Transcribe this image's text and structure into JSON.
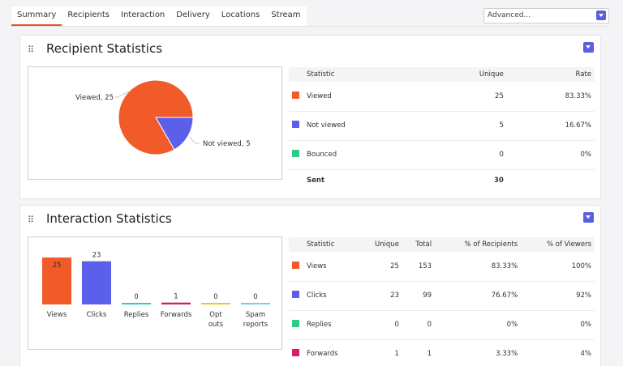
{
  "tabs": [
    {
      "label": "Summary",
      "active": true
    },
    {
      "label": "Recipients"
    },
    {
      "label": "Interaction"
    },
    {
      "label": "Delivery"
    },
    {
      "label": "Locations"
    },
    {
      "label": "Stream"
    }
  ],
  "view_select": {
    "value": "Advanced..."
  },
  "recipient_panel": {
    "title": "Recipient Statistics",
    "table": {
      "headers": [
        "Statistic",
        "Unique",
        "Rate"
      ],
      "rows": [
        {
          "label": "Viewed",
          "unique": "25",
          "rate": "83.33%",
          "color": "#f15a29"
        },
        {
          "label": "Not viewed",
          "unique": "5",
          "rate": "16.67%",
          "color": "#5b5fe9"
        },
        {
          "label": "Bounced",
          "unique": "0",
          "rate": "0%",
          "color": "#2ecc8a"
        }
      ],
      "total": {
        "label": "Sent",
        "unique": "30"
      }
    }
  },
  "interaction_panel": {
    "title": "Interaction Statistics",
    "table": {
      "headers": [
        "Statistic",
        "Unique",
        "Total",
        "% of Recipients",
        "% of Viewers"
      ],
      "rows": [
        {
          "label": "Views",
          "unique": "25",
          "total": "153",
          "pct_recipients": "83.33%",
          "pct_viewers": "100%",
          "color": "#f15a29"
        },
        {
          "label": "Clicks",
          "unique": "23",
          "total": "99",
          "pct_recipients": "76.67%",
          "pct_viewers": "92%",
          "color": "#5b5fe9"
        },
        {
          "label": "Replies",
          "unique": "0",
          "total": "0",
          "pct_recipients": "0%",
          "pct_viewers": "0%",
          "color": "#2ecc8a"
        },
        {
          "label": "Forwards",
          "unique": "1",
          "total": "1",
          "pct_recipients": "3.33%",
          "pct_viewers": "4%",
          "color": "#d81b6a"
        }
      ]
    }
  },
  "chart_data": [
    {
      "type": "pie",
      "slices": [
        {
          "label": "Viewed",
          "value": 25,
          "color": "#f15a29"
        },
        {
          "label": "Not viewed",
          "value": 5,
          "color": "#5b5fe9"
        }
      ]
    },
    {
      "type": "bar",
      "categories": [
        "Views",
        "Clicks",
        "Replies",
        "Forwards",
        "Opt outs",
        "Spam reports"
      ],
      "values": [
        25,
        23,
        0,
        1,
        0,
        0
      ],
      "colors": [
        "#f15a29",
        "#5b5fe9",
        "#1fd3c6",
        "#d81b6a",
        "#f5c518",
        "#6fd0f0"
      ],
      "ylim": [
        0,
        25
      ]
    }
  ]
}
